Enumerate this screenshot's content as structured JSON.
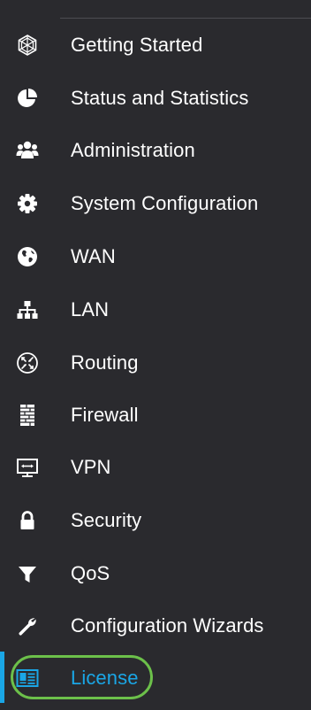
{
  "sidebar": {
    "items": [
      {
        "label": "Getting Started",
        "icon": "globe-mesh-icon"
      },
      {
        "label": "Status and Statistics",
        "icon": "pie-chart-icon"
      },
      {
        "label": "Administration",
        "icon": "users-group-icon"
      },
      {
        "label": "System Configuration",
        "icon": "gear-icon"
      },
      {
        "label": "WAN",
        "icon": "globe-icon"
      },
      {
        "label": "LAN",
        "icon": "sitemap-icon"
      },
      {
        "label": "Routing",
        "icon": "routing-icon"
      },
      {
        "label": "Firewall",
        "icon": "firewall-icon"
      },
      {
        "label": "VPN",
        "icon": "vpn-icon"
      },
      {
        "label": "Security",
        "icon": "lock-icon"
      },
      {
        "label": "QoS",
        "icon": "filter-icon"
      },
      {
        "label": "Configuration Wizards",
        "icon": "wrench-icon"
      },
      {
        "label": "License",
        "icon": "license-icon",
        "active": true
      }
    ]
  },
  "colors": {
    "background": "#2a2a2e",
    "text": "#ffffff",
    "active_text": "#1aa6e6",
    "highlight_outline": "#6cc04a"
  }
}
